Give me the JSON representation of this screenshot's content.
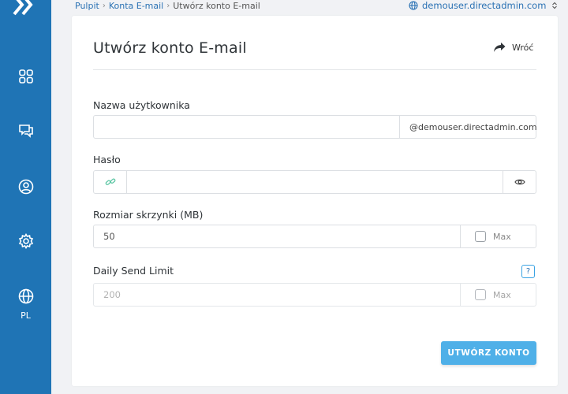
{
  "sidebar": {
    "lang": "PL",
    "items": [
      {
        "icon": "grid-icon"
      },
      {
        "icon": "chat-icon"
      },
      {
        "icon": "user-circle-icon"
      },
      {
        "icon": "gear-icon"
      },
      {
        "icon": "globe-icon"
      }
    ]
  },
  "breadcrumb": {
    "items": [
      "Pulpit",
      "Konta E-mail",
      "Utwórz konto E-mail"
    ]
  },
  "domain_selector": "demouser.directadmin.com",
  "card": {
    "title": "Utwórz konto E-mail",
    "back_label": "Wróć"
  },
  "form": {
    "username": {
      "label": "Nazwa użytkownika",
      "value": "",
      "suffix": "@demouser.directadmin.com"
    },
    "password": {
      "label": "Hasło",
      "value": ""
    },
    "mailbox_size": {
      "label": "Rozmiar skrzynki (MB)",
      "value": "50",
      "max_label": "Max"
    },
    "send_limit": {
      "label": "Daily Send Limit",
      "value": "200",
      "max_label": "Max",
      "help": "?"
    }
  },
  "submit_label": "UTWÓRZ KONTO",
  "colors": {
    "sidebar": "#1f74b5",
    "link": "#2b72b4",
    "button": "#4fb0e8",
    "background": "#f1f2f5"
  }
}
